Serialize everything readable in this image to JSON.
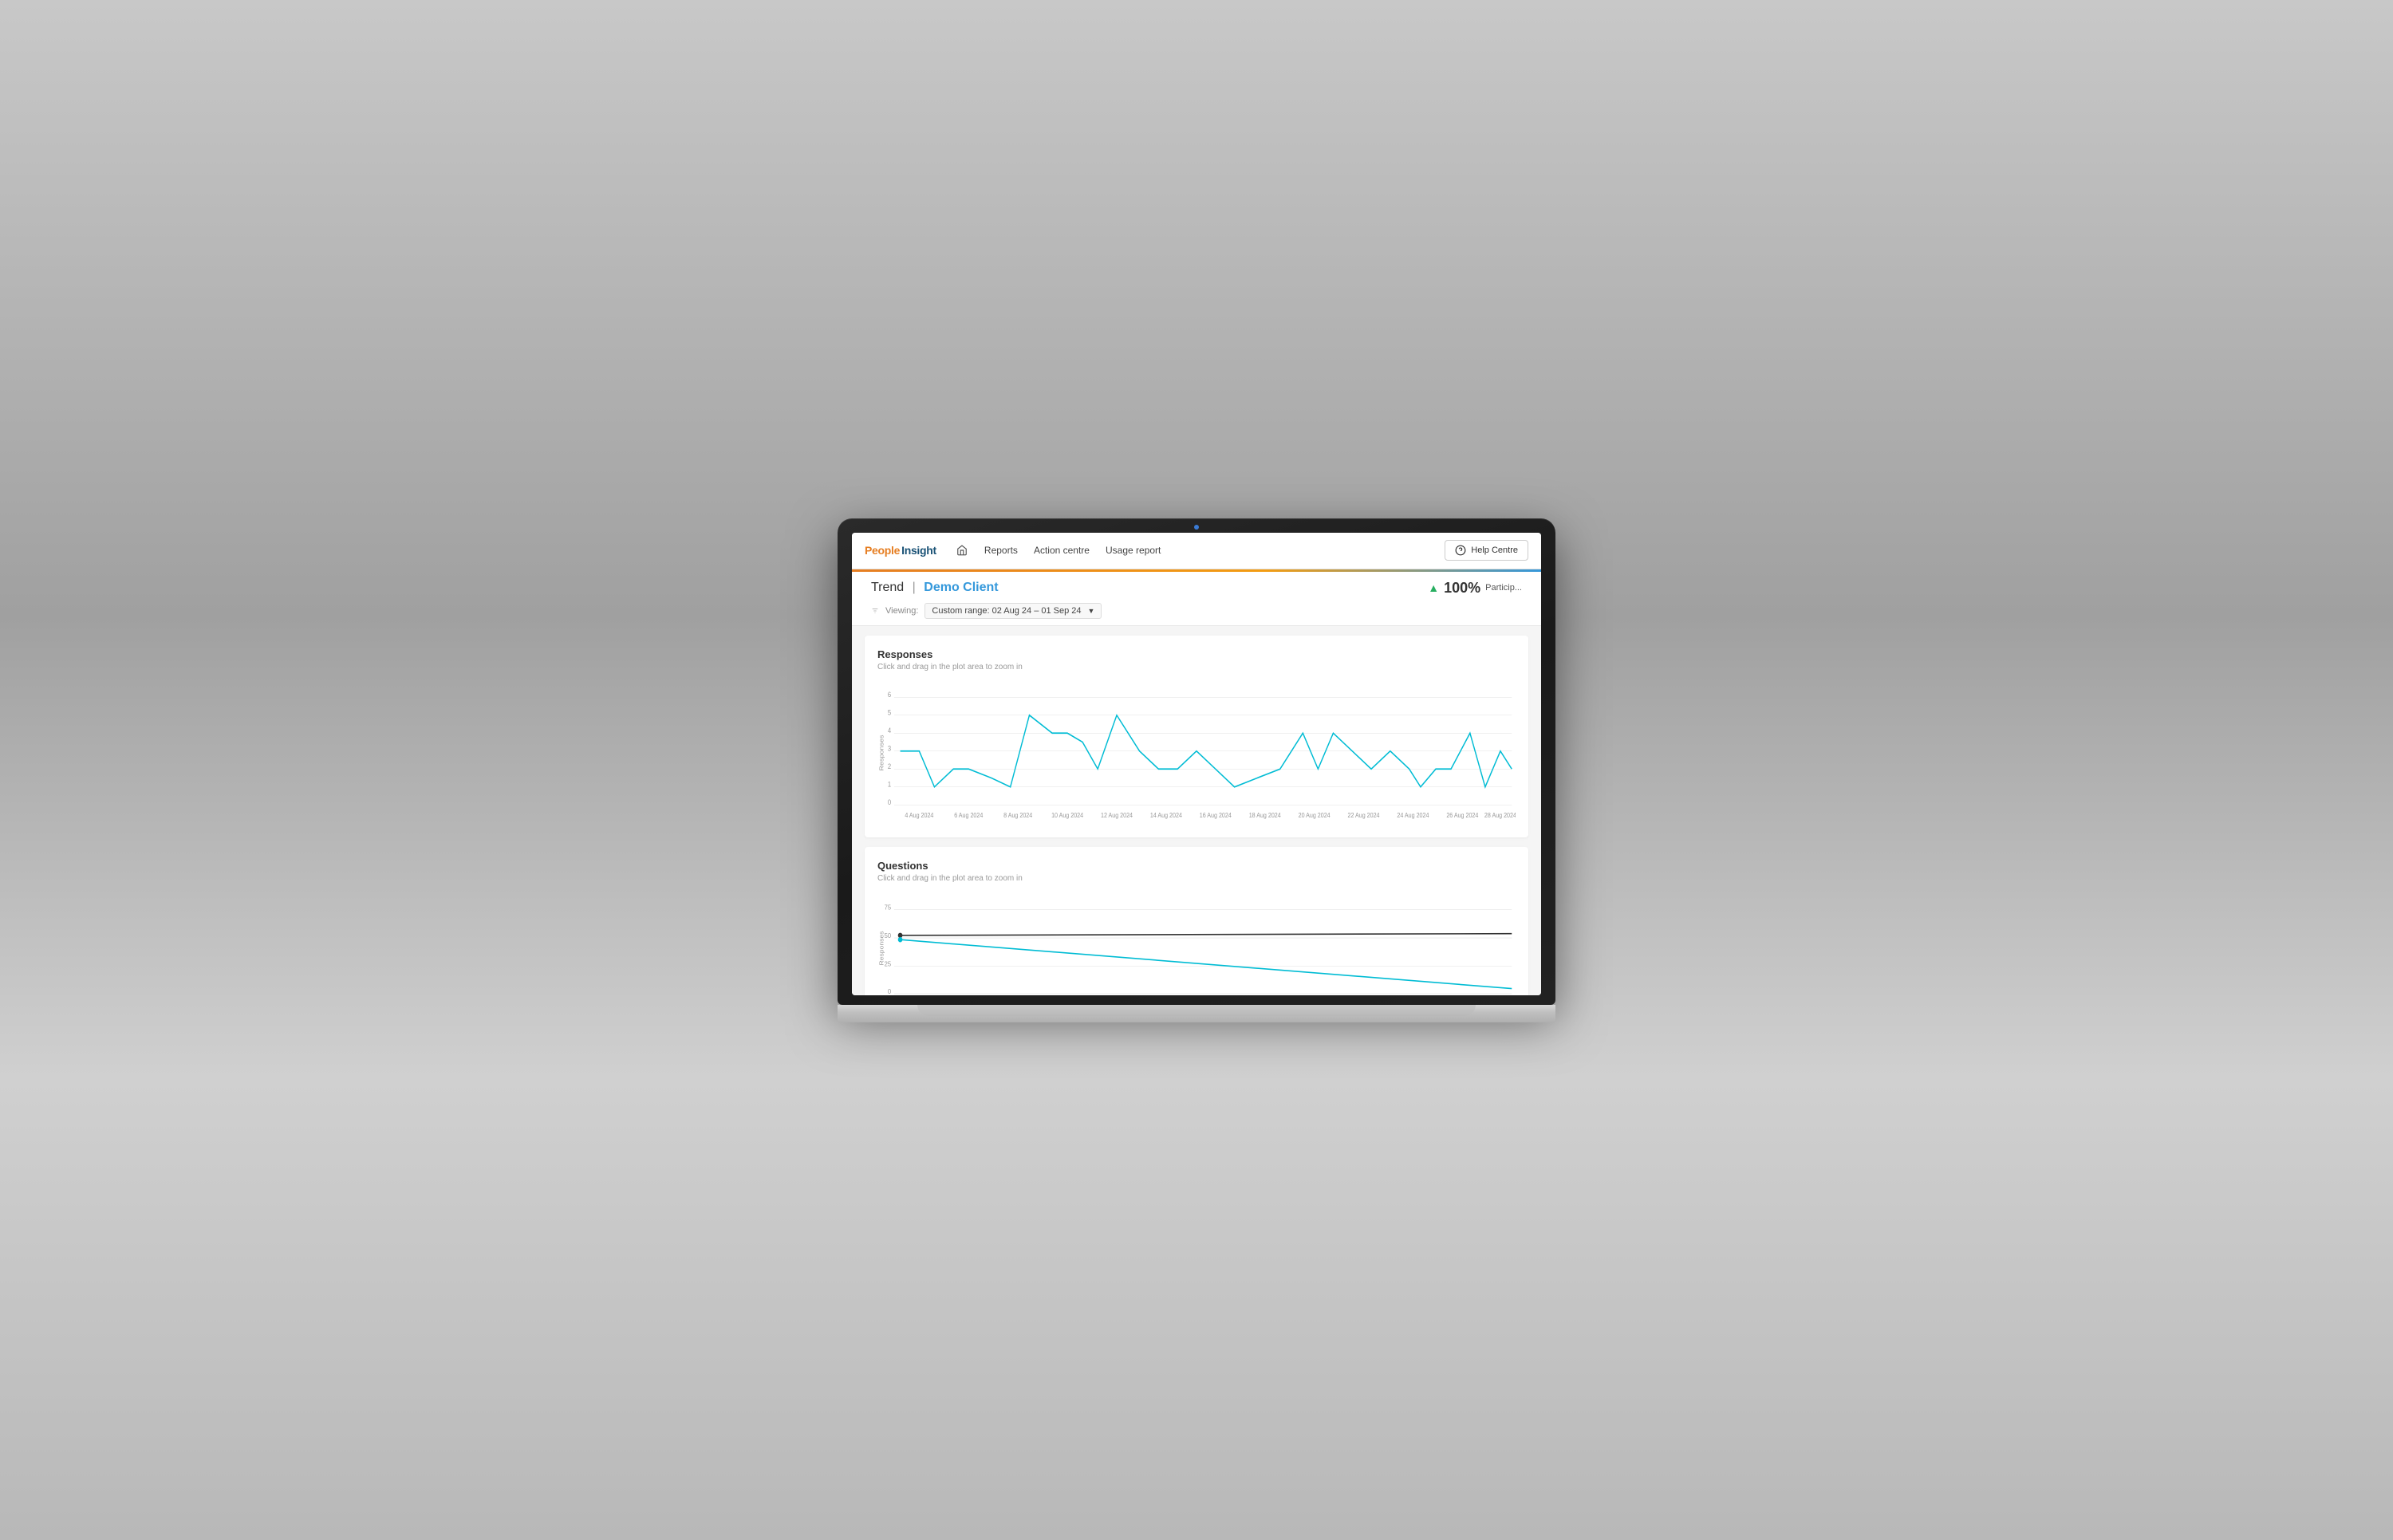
{
  "app": {
    "name": "PeopleInsight"
  },
  "navbar": {
    "logo_text1": "People",
    "logo_text2": "Insight",
    "home_label": "Home",
    "links": [
      {
        "label": "Reports",
        "id": "reports"
      },
      {
        "label": "Action centre",
        "id": "action-centre"
      },
      {
        "label": "Usage report",
        "id": "usage-report"
      }
    ],
    "help_button": "Help Centre"
  },
  "page": {
    "title": "Trend",
    "separator": "|",
    "client_name": "Demo Client",
    "viewing_label": "Viewing:",
    "date_range": "Custom range: 02 Aug 24 – 01 Sep 24",
    "participation_pct": "100%",
    "participation_label": "Particip..."
  },
  "responses_chart": {
    "title": "Responses",
    "hint": "Click and drag in the plot area to zoom in",
    "y_labels": [
      "6",
      "5",
      "4",
      "3",
      "2",
      "1",
      "0"
    ],
    "x_labels": [
      "4 Aug 2024",
      "6 Aug 2024",
      "8 Aug 2024",
      "10 Aug 2024",
      "12 Aug 2024",
      "14 Aug 2024",
      "16 Aug 2024",
      "18 Aug 2024",
      "20 Aug 2024",
      "22 Aug 2024",
      "24 Aug 2024",
      "26 Aug 2024",
      "28 Aug 2024"
    ],
    "y_axis_title": "Responses"
  },
  "questions_chart": {
    "title": "Questions",
    "hint": "Click and drag in the plot area to zoom in",
    "y_labels": [
      "75",
      "50",
      "25",
      "0"
    ],
    "y_axis_title": "Responses"
  }
}
